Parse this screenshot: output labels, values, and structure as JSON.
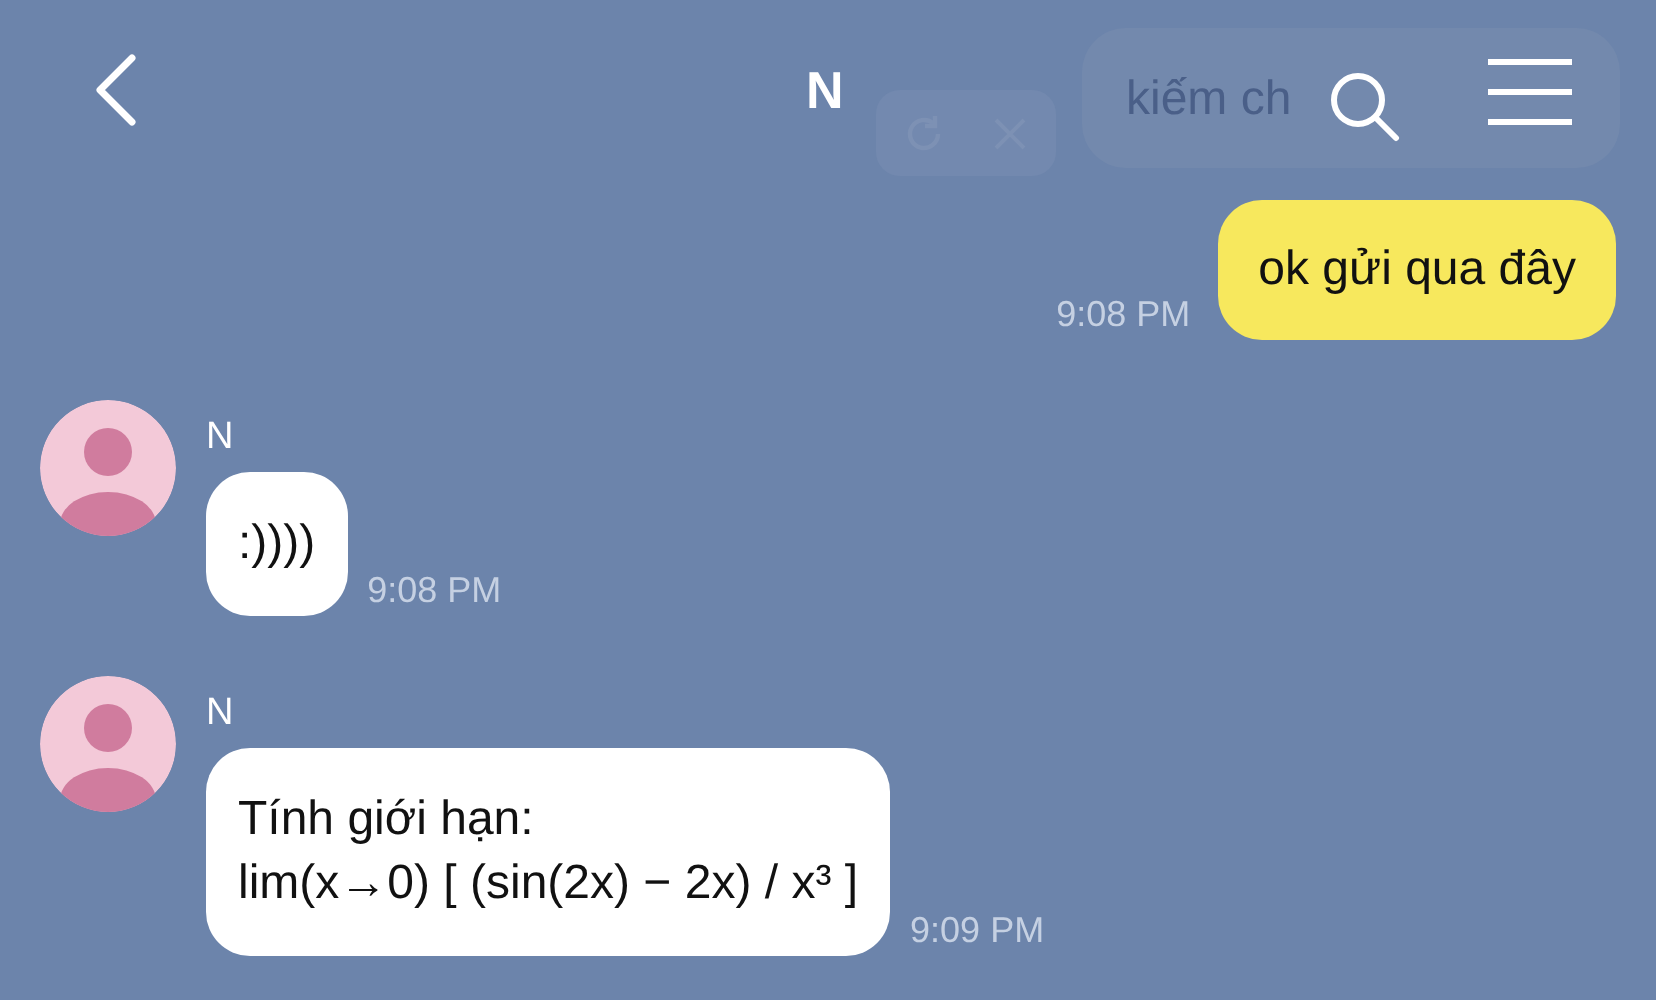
{
  "header": {
    "title": "N"
  },
  "faded_message": {
    "text": "kiếm ch"
  },
  "messages": [
    {
      "kind": "outgoing",
      "text": "ok gửi qua đây",
      "time": "9:08 PM"
    },
    {
      "kind": "incoming",
      "sender": "N",
      "text": ":))))",
      "time": "9:08 PM"
    },
    {
      "kind": "incoming",
      "sender": "N",
      "text": "Tính giới hạn:\nlim(x→0)  [ (sin(2x) − 2x) / x³ ]",
      "time": "9:09 PM"
    }
  ]
}
